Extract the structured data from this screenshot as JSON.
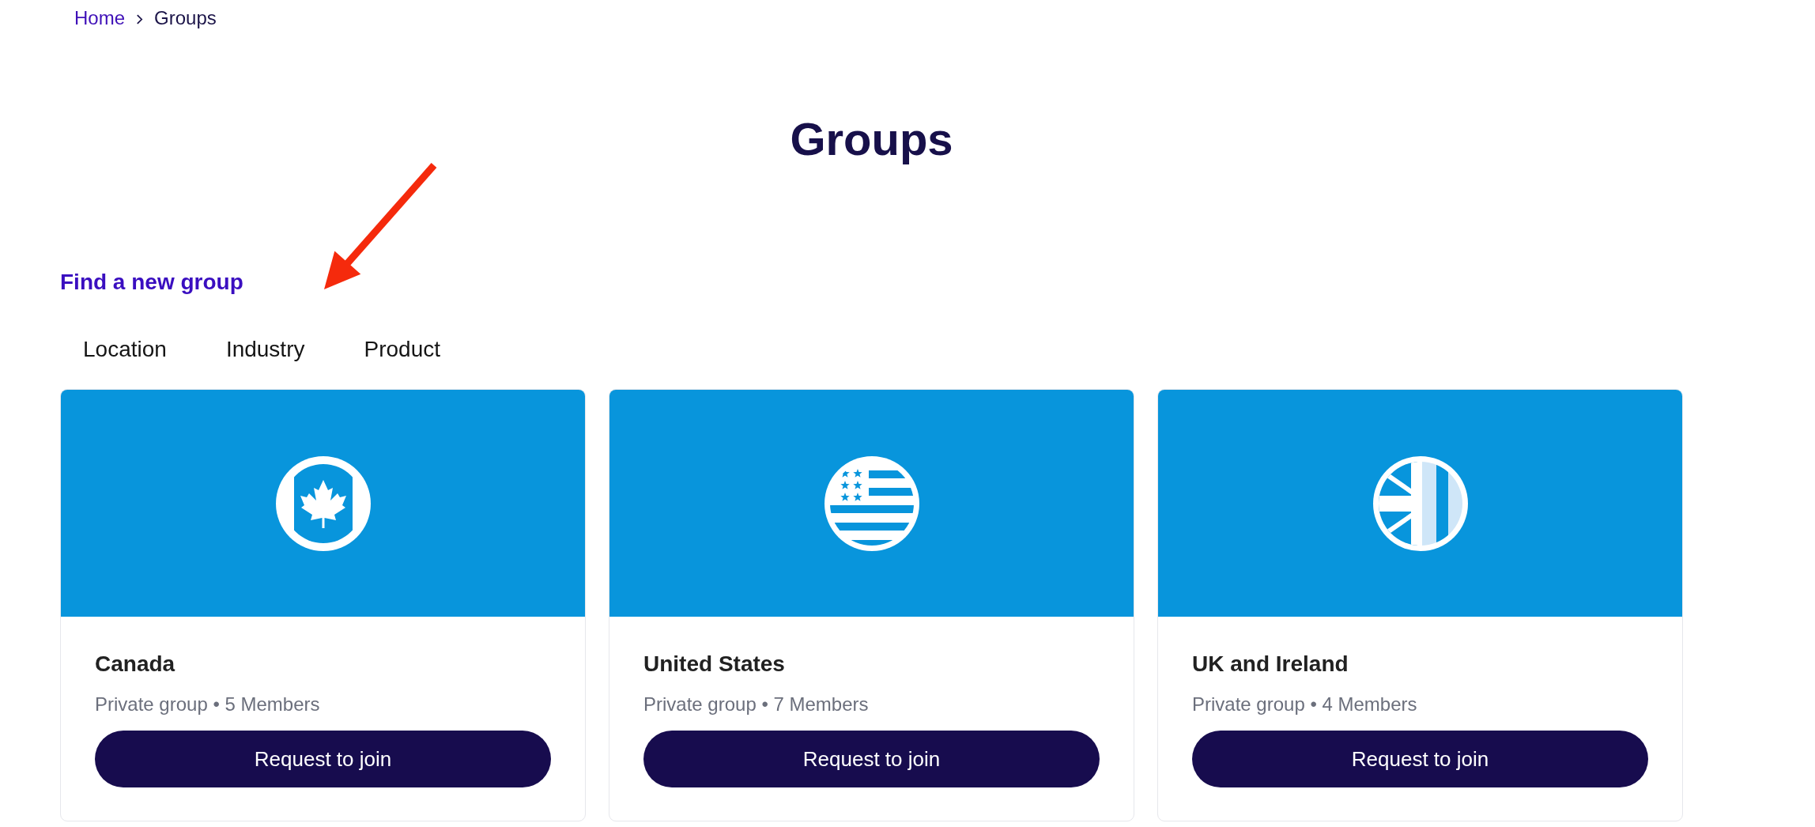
{
  "breadcrumb": [
    {
      "label": "Home",
      "kind": "link"
    },
    {
      "label": "Groups",
      "kind": "current"
    }
  ],
  "title": "Groups",
  "section_heading": "Find a new group",
  "tabs": [
    {
      "label": "Location"
    },
    {
      "label": "Industry"
    },
    {
      "label": "Product"
    }
  ],
  "groups": [
    {
      "kind": "canada",
      "name": "Canada",
      "meta": "Private group • 5 Members",
      "button": "Request to join"
    },
    {
      "kind": "usa",
      "name": "United States",
      "meta": "Private group • 7 Members",
      "button": "Request to join"
    },
    {
      "kind": "uk",
      "name": "UK and Ireland",
      "meta": "Private group • 4 Members",
      "button": "Request to join"
    }
  ]
}
